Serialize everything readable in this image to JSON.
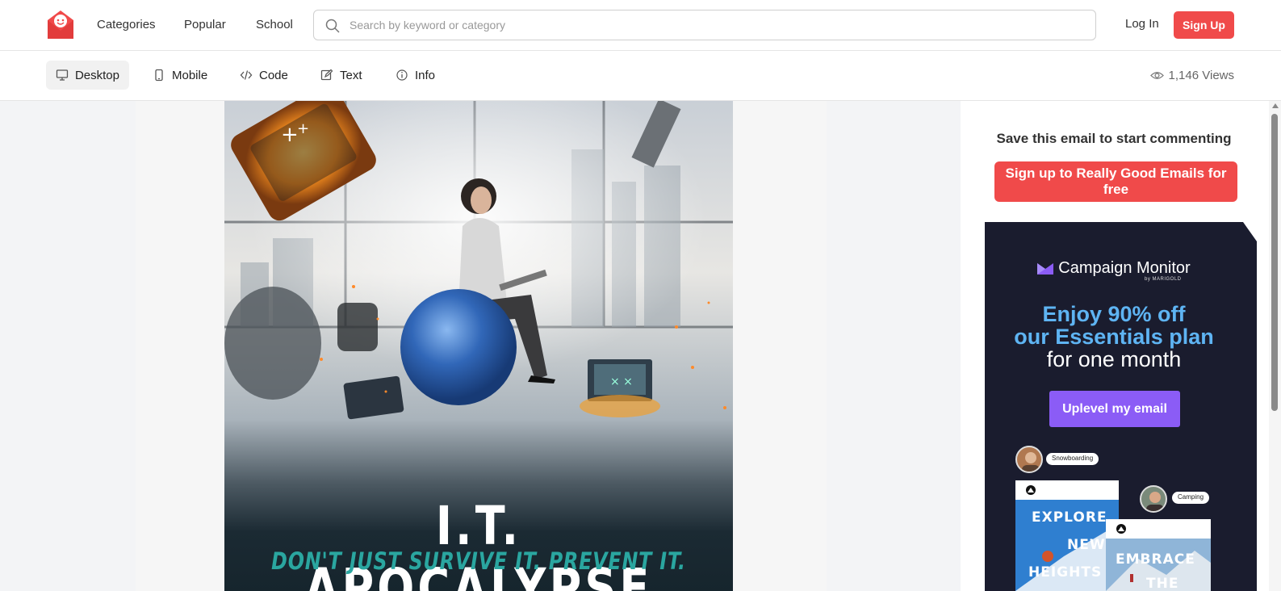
{
  "nav": {
    "links": [
      "Categories",
      "Popular",
      "School"
    ],
    "search_placeholder": "Search by keyword or category",
    "login_label": "Log In",
    "signup_label": "Sign Up"
  },
  "toolbar": {
    "tabs": [
      {
        "label": "Desktop",
        "icon": "monitor-icon"
      },
      {
        "label": "Mobile",
        "icon": "phone-icon"
      },
      {
        "label": "Code",
        "icon": "code-icon"
      },
      {
        "label": "Text",
        "icon": "edit-icon"
      },
      {
        "label": "Info",
        "icon": "info-icon"
      }
    ],
    "active_tab": "Desktop",
    "views": "1,146 Views"
  },
  "email": {
    "title": "I.T. APOCALYPSE",
    "subtitle": "DON'T JUST SURVIVE IT. PREVENT IT."
  },
  "sidebar": {
    "comment_heading": "Save this email to start commenting",
    "comment_cta": "Sign up to Really Good Emails for free"
  },
  "ad": {
    "brand": "Campaign Monitor",
    "brand_by": "by MARIGOLD",
    "headline_1": "Enjoy 90% off",
    "headline_2": "our Essentials plan",
    "headline_3": "for one month",
    "cta": "Uplevel my email",
    "tag_1": "Snowboarding",
    "tag_2": "Camping",
    "card_1_title_1": "EXPLORE",
    "card_1_title_2": "NEW",
    "card_1_title_3": "HEIGHTS",
    "card_2_title_1": "EMBRACE",
    "card_2_title_2": "THE"
  },
  "colors": {
    "brand_red": "#f04a4a",
    "ad_bg": "#1a1c2e",
    "ad_accent": "#8b5cf6",
    "ad_headline": "#5eb4f3"
  }
}
